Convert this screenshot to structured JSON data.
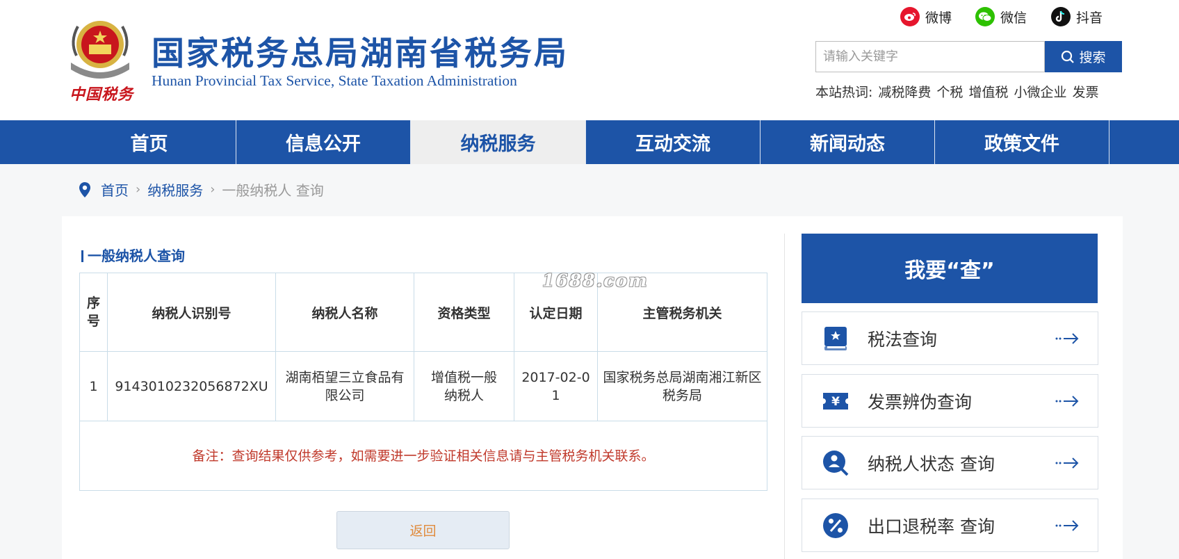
{
  "header": {
    "title": "国家税务总局湖南省税务局",
    "subtitle": "Hunan Provincial  Tax Service,  State Taxation Administration",
    "seal_text": "中国税务",
    "social": [
      {
        "icon": "weibo-icon",
        "label": "微博"
      },
      {
        "icon": "wechat-icon",
        "label": "微信"
      },
      {
        "icon": "douyin-icon",
        "label": "抖音"
      }
    ],
    "search": {
      "placeholder": "请输入关键字",
      "button_label": "搜索"
    },
    "hot": {
      "label": "本站热词:",
      "items": [
        "减税降费",
        "个税",
        "增值税",
        "小微企业",
        "发票"
      ]
    }
  },
  "nav": {
    "items": [
      "首页",
      "信息公开",
      "纳税服务",
      "互动交流",
      "新闻动态",
      "政策文件"
    ],
    "active": "纳税服务"
  },
  "breadcrumb": {
    "items": [
      "首页",
      "纳税服务",
      "一般纳税人 查询"
    ]
  },
  "main": {
    "section_title": "一般纳税人查询",
    "watermark": "1688.com",
    "table": {
      "headers": [
        "序号",
        "纳税人识别号",
        "纳税人名称",
        "资格类型",
        "认定日期",
        "主管税务机关"
      ],
      "rows": [
        [
          "1",
          "9143010232056872XU",
          "湖南栢望三立食品有限公司",
          "增值税一般纳税人",
          "2017-02-01",
          "国家税务总局湖南湘江新区税务局"
        ]
      ],
      "note": "备注：查询结果仅供参考，如需要进一步验证相关信息请与主管税务机关联系。"
    },
    "back_label": "返回"
  },
  "sidebar": {
    "heading": "我要“查”",
    "items": [
      {
        "label": "税法查询",
        "icon": "book-icon"
      },
      {
        "label": "发票辨伪查询",
        "icon": "invoice-icon"
      },
      {
        "label": "纳税人状态 查询",
        "icon": "person-search-icon"
      },
      {
        "label": "出口退税率 查询",
        "icon": "percent-icon"
      }
    ]
  },
  "colors": {
    "brand_blue": "#1d54a7",
    "note_red": "#c0392b",
    "back_text": "#e08a3b"
  }
}
